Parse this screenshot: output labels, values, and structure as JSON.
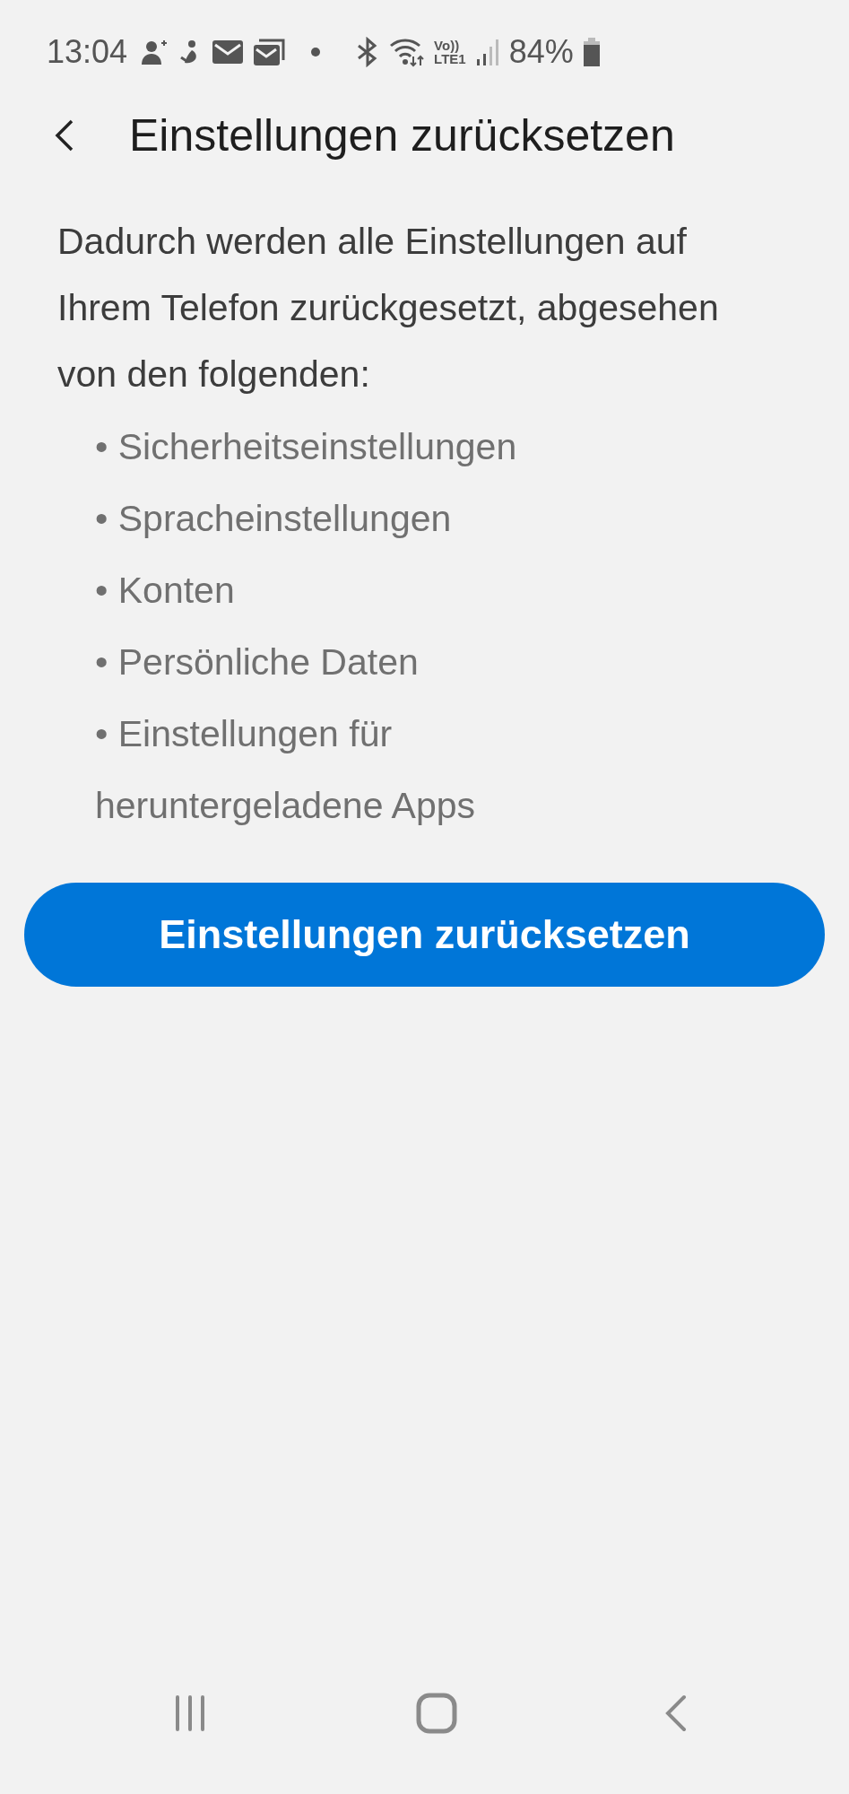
{
  "status_bar": {
    "time": "13:04",
    "volte": "Vo))",
    "lte": "LTE1",
    "battery": "84%"
  },
  "header": {
    "title": "Einstellungen zurücksetzen"
  },
  "description": "Dadurch werden alle Einstellungen auf Ihrem Telefon zurückgesetzt, abgesehen von den folgenden:",
  "exceptions": [
    "• Sicherheitseinstellungen",
    "• Spracheinstellungen",
    "• Konten",
    "• Persönliche Daten",
    "• Einstellungen für heruntergeladene Apps"
  ],
  "button": {
    "label": "Einstellungen zurücksetzen"
  }
}
